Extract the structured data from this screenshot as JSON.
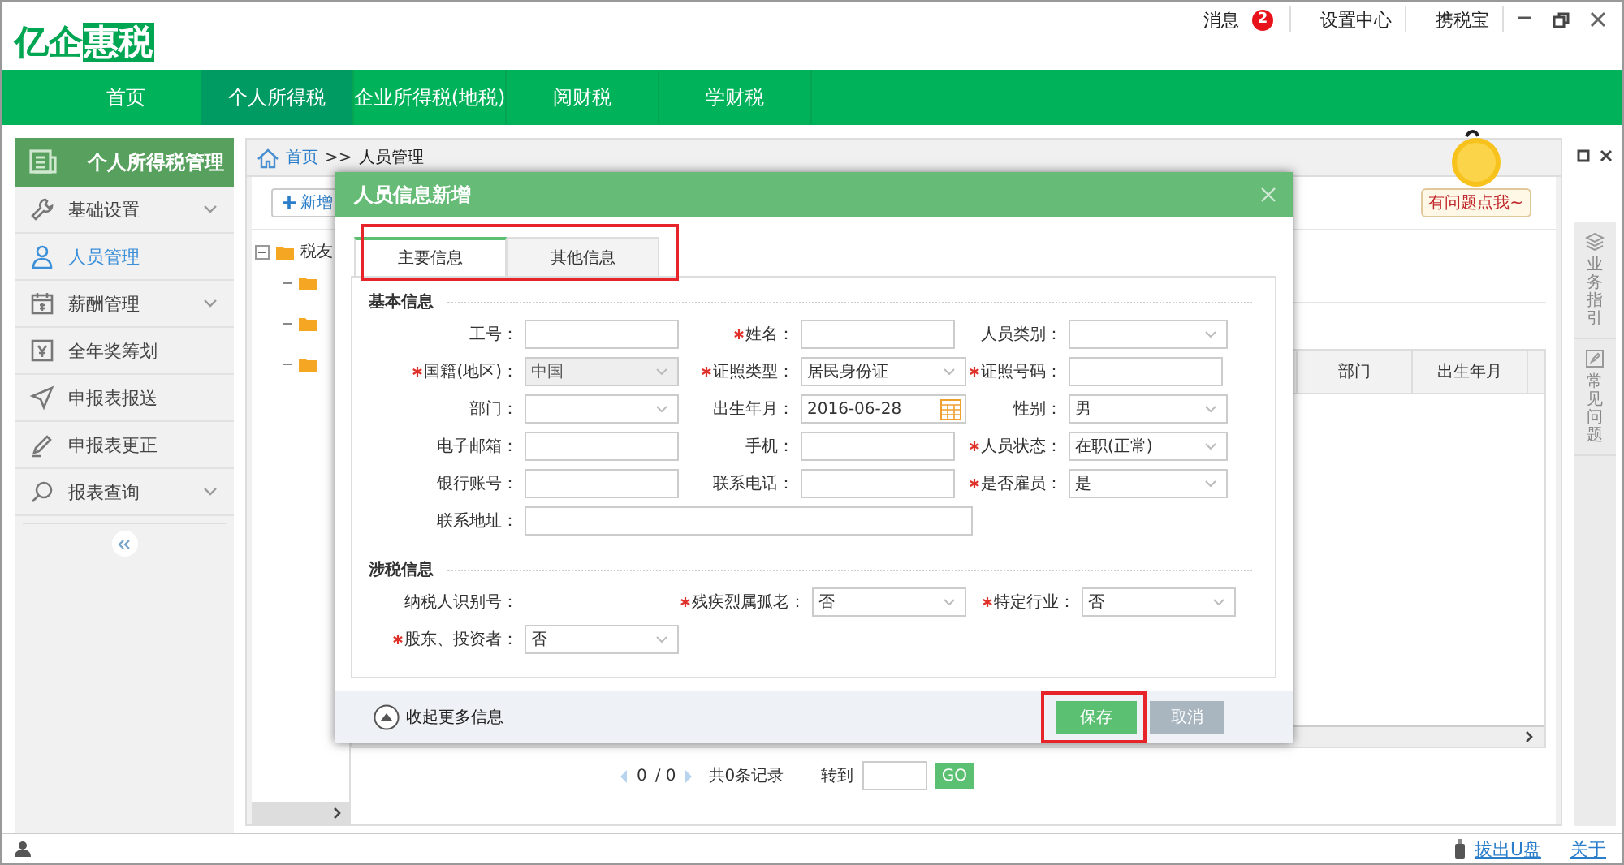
{
  "header": {
    "logo": {
      "part_1": "亿企",
      "part_2": "惠税"
    },
    "links": [
      {
        "label": "消息",
        "badge": "2"
      },
      {
        "label": "设置中心"
      },
      {
        "label": "携税宝"
      }
    ]
  },
  "nav": [
    {
      "label": "首页",
      "selected": false
    },
    {
      "label": "个人所得税",
      "selected": true
    },
    {
      "label": "企业所得税(地税)",
      "selected": false
    },
    {
      "label": "阅财税",
      "selected": false
    },
    {
      "label": "学财税",
      "selected": false
    }
  ],
  "sidebar": {
    "title": "个人所得税管理",
    "items": [
      {
        "label": "基础设置",
        "expandable": true,
        "selected": false
      },
      {
        "label": "人员管理",
        "expandable": false,
        "selected": true
      },
      {
        "label": "薪酬管理",
        "expandable": true,
        "selected": false
      },
      {
        "label": "全年奖筹划",
        "expandable": false,
        "selected": false
      },
      {
        "label": "申报表报送",
        "expandable": false,
        "selected": false
      },
      {
        "label": "申报表更正",
        "expandable": false,
        "selected": false
      },
      {
        "label": "报表查询",
        "expandable": true,
        "selected": false
      }
    ]
  },
  "breadcrumb": {
    "home": "首页",
    "separator": ">>",
    "current": "人员管理"
  },
  "toolbar": {
    "add_button": "新增"
  },
  "tree": [
    {
      "label": "税友",
      "expanded": true,
      "children": [
        {
          "kind": "folder"
        },
        {
          "kind": "folder"
        },
        {
          "kind": "folder"
        }
      ]
    }
  ],
  "table": {
    "columns": [
      {
        "label": "部门"
      },
      {
        "label": "出生年月"
      }
    ]
  },
  "pagination": {
    "page": "0",
    "total_pages": "/ 0",
    "records": "共0条记录",
    "goto_label": "转到",
    "go_button": "GO"
  },
  "help_tabs": [
    {
      "label": "业务指引"
    },
    {
      "label": "常见问题"
    }
  ],
  "mascot": {
    "speech": "有问题点我~"
  },
  "status_bar": {
    "links": [
      "拔出U盘",
      "关于"
    ]
  },
  "dialog": {
    "title": "人员信息新增",
    "tabs_highlighted": true,
    "tabs": [
      {
        "label": "主要信息",
        "selected": true
      },
      {
        "label": "其他信息",
        "selected": false
      }
    ],
    "sections": [
      {
        "title": "基本信息",
        "fields": [
          {
            "label": "工号：",
            "required": false,
            "kind": "text",
            "disabled": false
          },
          {
            "label": "姓名：",
            "required": true,
            "kind": "text",
            "disabled": false
          },
          {
            "label": "人员类别：",
            "required": false,
            "kind": "select",
            "disabled": false
          },
          {
            "label": "国籍(地区)：",
            "required": true,
            "kind": "select",
            "value": "中国",
            "disabled": true
          },
          {
            "label": "证照类型：",
            "required": true,
            "kind": "select",
            "value": "居民身份证",
            "disabled": false
          },
          {
            "label": "证照号码：",
            "required": true,
            "kind": "text",
            "disabled": false
          },
          {
            "label": "部门：",
            "required": false,
            "kind": "select",
            "disabled": false
          },
          {
            "label": "出生年月：",
            "required": false,
            "kind": "date",
            "value": "2016-06-28",
            "disabled": false
          },
          {
            "label": "性别：",
            "required": false,
            "kind": "select",
            "value": "男",
            "disabled": false
          },
          {
            "label": "电子邮箱：",
            "required": false,
            "kind": "text",
            "disabled": false
          },
          {
            "label": "手机：",
            "required": false,
            "kind": "text",
            "disabled": false
          },
          {
            "label": "人员状态：",
            "required": true,
            "kind": "select",
            "value": "在职(正常)",
            "disabled": false
          },
          {
            "label": "银行账号：",
            "required": false,
            "kind": "text",
            "disabled": false
          },
          {
            "label": "联系电话：",
            "required": false,
            "kind": "text",
            "disabled": false
          },
          {
            "label": "是否雇员：",
            "required": true,
            "kind": "select",
            "value": "是",
            "disabled": false
          },
          {
            "label": "联系地址：",
            "required": false,
            "kind": "wide_text",
            "disabled": false
          }
        ]
      },
      {
        "title": "涉税信息",
        "fields": [
          {
            "label": "纳税人识别号：",
            "required": false,
            "kind": "label"
          },
          {
            "label": "残疾烈属孤老：",
            "required": true,
            "kind": "select",
            "value": "否",
            "disabled": false
          },
          {
            "label": "特定行业：",
            "required": true,
            "kind": "select",
            "value": "否",
            "disabled": false
          },
          {
            "label": "股东、投资者：",
            "required": true,
            "kind": "select",
            "value": "否",
            "disabled": false
          }
        ]
      }
    ],
    "footer": {
      "collapse": "收起更多信息",
      "save": "保存",
      "cancel": "取消",
      "save_highlighted": true
    }
  }
}
